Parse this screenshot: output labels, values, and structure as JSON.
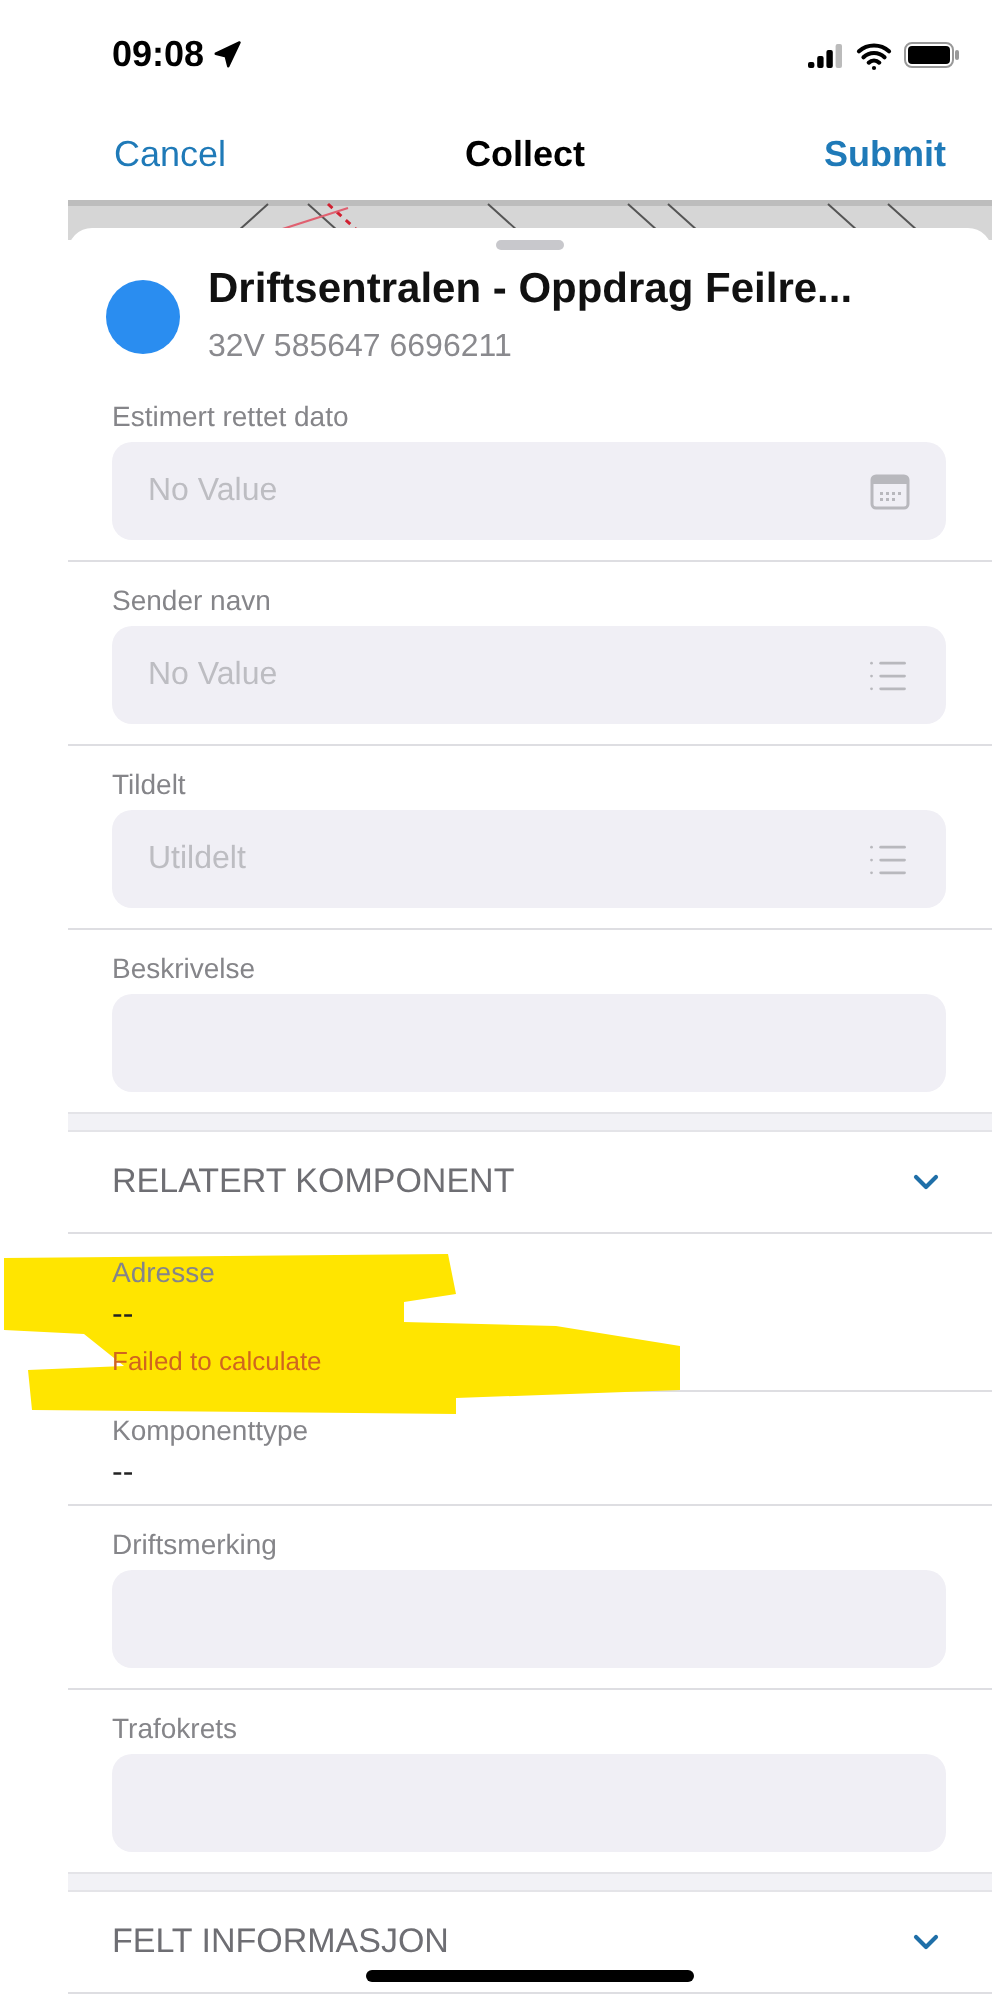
{
  "status_bar": {
    "time": "09:08"
  },
  "nav": {
    "cancel": "Cancel",
    "title": "Collect",
    "submit": "Submit"
  },
  "header": {
    "title": "Driftsentralen - Oppdrag Feilre...",
    "subtitle": "32V 585647 6696211"
  },
  "fields": [
    {
      "kind": "date",
      "label": "Estimert rettet dato",
      "placeholder": "No Value"
    },
    {
      "kind": "choice",
      "label": "Sender navn",
      "placeholder": "No Value"
    },
    {
      "kind": "choice",
      "label": "Tildelt",
      "placeholder": "Utildelt"
    },
    {
      "kind": "text",
      "label": "Beskrivelse"
    }
  ],
  "sections": [
    {
      "title": "RELATERT KOMPONENT",
      "fields": [
        {
          "kind": "readonly",
          "label": "Adresse",
          "value": "--",
          "error": "Failed to calculate",
          "highlighted": true
        },
        {
          "kind": "readonly",
          "label": "Komponenttype",
          "value": "--",
          "highlighted": false
        },
        {
          "kind": "text",
          "label": "Driftsmerking"
        },
        {
          "kind": "text",
          "label": "Trafokrets"
        }
      ]
    },
    {
      "title": "FELT INFORMASJON"
    }
  ]
}
